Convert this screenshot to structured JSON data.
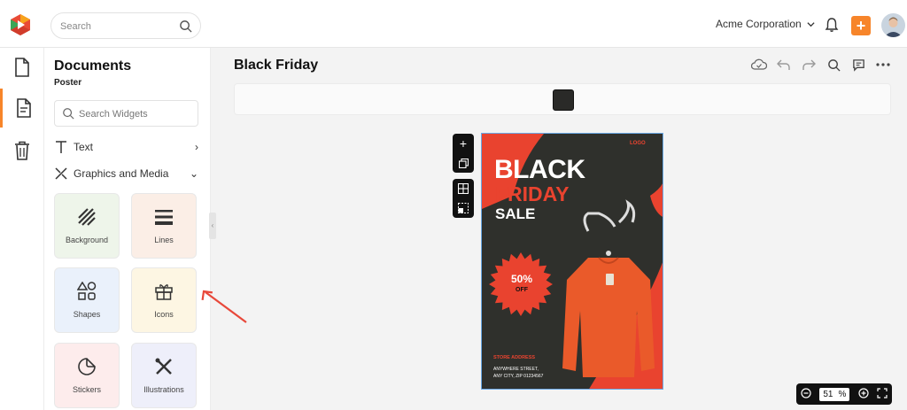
{
  "topbar": {
    "search_placeholder": "Search",
    "org_name": "Acme Corporation",
    "add_label": "+"
  },
  "rail": {
    "items": [
      {
        "icon": "document-icon"
      },
      {
        "icon": "document-lines-icon",
        "active": true
      },
      {
        "icon": "trash-icon"
      }
    ]
  },
  "panel": {
    "title": "Documents",
    "subtitle": "Poster",
    "search_placeholder": "Search Widgets",
    "sections": [
      {
        "icon": "text-icon",
        "label": "Text",
        "chevron": "›"
      },
      {
        "icon": "graphics-icon",
        "label": "Graphics and Media",
        "chevron": "⌄"
      }
    ],
    "tiles": [
      {
        "label": "Background",
        "color": "#eef5ea"
      },
      {
        "label": "Lines",
        "color": "#fbeee6"
      },
      {
        "label": "Shapes",
        "color": "#eaf1fb"
      },
      {
        "label": "Icons",
        "color": "#fdf6e3"
      },
      {
        "label": "Stickers",
        "color": "#fdecec"
      },
      {
        "label": "Illustrations",
        "color": "#eeeffa"
      }
    ]
  },
  "main": {
    "doc_title": "Black Friday",
    "selected_color": "#2a2a28",
    "zoom_value": "51",
    "zoom_unit": "%"
  },
  "poster": {
    "logo_text": "LOGO",
    "line1": "BLACK",
    "line2": "FRIDAY",
    "line3": "SALE",
    "badge_value": "50%",
    "badge_text": "OFF",
    "store_label": "STORE ADDRESS",
    "address_line1": "ANYWHERE STREET,",
    "address_line2": "ANY CITY, ZIP 01234567",
    "accent": "#e9432f",
    "background": "#2f302c"
  },
  "colors": {
    "brand_orange": "#f7852a"
  }
}
